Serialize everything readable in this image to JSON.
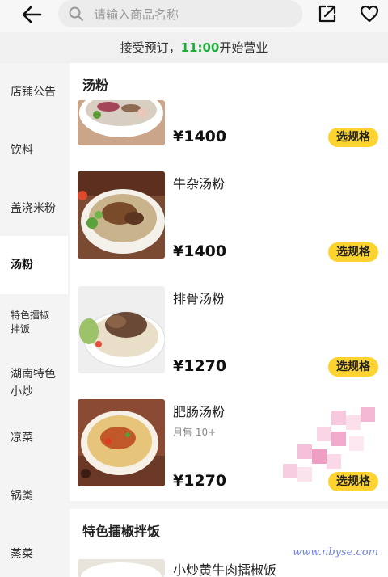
{
  "search": {
    "placeholder": "请输入商品名称"
  },
  "icons": {
    "back": "arrow-left-icon",
    "search": "search-icon",
    "share": "share-icon",
    "favorite": "heart-icon"
  },
  "notice": {
    "prefix": "接受预订，",
    "time": "11:00",
    "suffix": "开始营业"
  },
  "sidebar": {
    "items": [
      {
        "label": "店铺公告"
      },
      {
        "label": "饮料"
      },
      {
        "label": "盖浇米粉"
      },
      {
        "label": "汤粉",
        "active": true
      },
      {
        "label": "特色擂椒拌饭"
      },
      {
        "label": "湖南特色小炒"
      },
      {
        "label": "凉菜"
      },
      {
        "label": "锅类"
      },
      {
        "label": "蒸菜"
      }
    ]
  },
  "sections": [
    {
      "title": "汤粉",
      "products": [
        {
          "name": "",
          "price": "¥1400",
          "button": "选规格"
        },
        {
          "name": "牛杂汤粉",
          "price": "¥1400",
          "button": "选规格"
        },
        {
          "name": "排骨汤粉",
          "price": "¥1270",
          "button": "选规格"
        },
        {
          "name": "肥肠汤粉",
          "sold": "月售 10+",
          "price": "¥1270",
          "button": "选规格"
        }
      ]
    },
    {
      "title": "特色擂椒拌饭",
      "products": [
        {
          "name": "小炒黄牛肉擂椒饭"
        }
      ]
    }
  ],
  "watermark": "www.nbyse.com",
  "colors": {
    "accent_yellow": "#fdd32f",
    "time_green": "#1fab3a"
  }
}
